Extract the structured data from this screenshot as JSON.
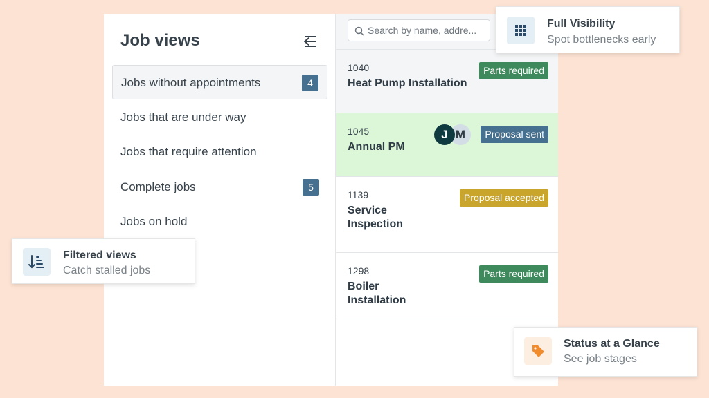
{
  "sidebar": {
    "title": "Job views",
    "collapse_icon": "collapse-menu-icon",
    "items": [
      {
        "label": "Jobs without appointments",
        "count": "4",
        "active": true
      },
      {
        "label": "Jobs that are under way"
      },
      {
        "label": "Jobs that require attention"
      },
      {
        "label": "Complete jobs",
        "count": "5"
      },
      {
        "label": "Jobs on hold"
      }
    ]
  },
  "search": {
    "placeholder": "Search by name, addre...",
    "icon": "search-icon"
  },
  "jobs": [
    {
      "number": "1040",
      "title": "Heat Pump Installation",
      "status": "Parts required",
      "status_color": "#3f8a5c"
    },
    {
      "number": "1045",
      "title": "Annual PM",
      "status": "Proposal sent",
      "status_color": "#46708f",
      "highlight": "#dcf7d7",
      "avatars": [
        {
          "initial": "J",
          "bg": "#0e3a40",
          "fg": "#ffffff"
        },
        {
          "initial": "M",
          "bg": "#d3dde5",
          "fg": "#2f3b45"
        }
      ]
    },
    {
      "number": "1139",
      "title_lines": [
        "Service",
        "Inspection"
      ],
      "status": "Proposal accepted",
      "status_color": "#c9a52b"
    },
    {
      "number": "1298",
      "title_lines": [
        "Boiler",
        "Installation"
      ],
      "status": "Parts required",
      "status_color": "#3f8a5c"
    }
  ],
  "callouts": {
    "visibility": {
      "title": "Full Visibility",
      "subtitle": "Spot bottlenecks early",
      "icon": "grid-icon",
      "icon_bg": "#e3eef5",
      "icon_color": "#2a4a68"
    },
    "filtered": {
      "title": "Filtered views",
      "subtitle": "Catch stalled jobs",
      "icon": "sort-descending-icon",
      "icon_bg": "#e3eef5",
      "icon_color": "#2a4a68"
    },
    "status": {
      "title": "Status at a Glance",
      "subtitle": "See job stages",
      "icon": "tag-icon",
      "icon_bg": "#fdeee2",
      "icon_color": "#f08c2e"
    }
  },
  "colors": {
    "background": "#fde3d3",
    "badge": "#46708f"
  }
}
